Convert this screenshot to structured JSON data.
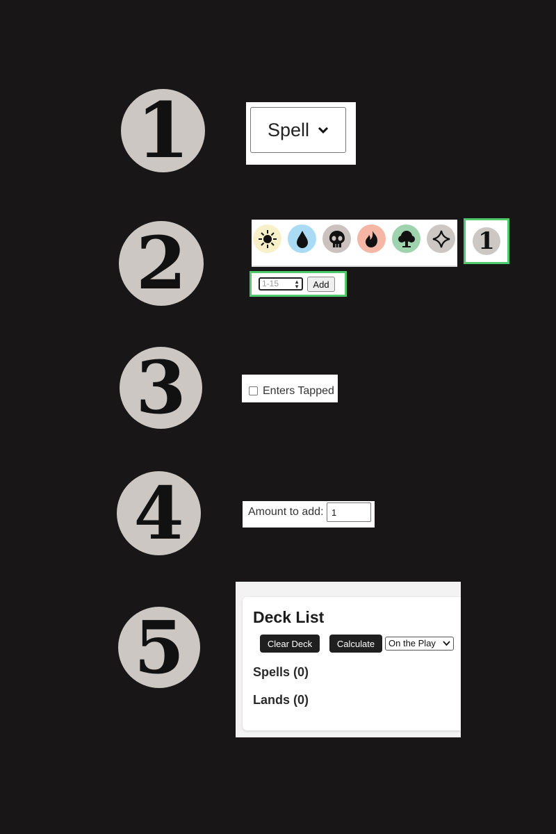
{
  "steps": [
    {
      "number": "1"
    },
    {
      "number": "2"
    },
    {
      "number": "3"
    },
    {
      "number": "4"
    },
    {
      "number": "5"
    }
  ],
  "step1": {
    "card_type_select": {
      "value": "Spell"
    }
  },
  "step2": {
    "mana_symbols": [
      {
        "name": "white",
        "icon": "sun-icon",
        "bg": "#f8f0c8"
      },
      {
        "name": "blue",
        "icon": "water-drop-icon",
        "bg": "#a9dcf4"
      },
      {
        "name": "black",
        "icon": "skull-icon",
        "bg": "#cbc2bf"
      },
      {
        "name": "red",
        "icon": "fire-icon",
        "bg": "#f5b6a6"
      },
      {
        "name": "green",
        "icon": "tree-icon",
        "bg": "#9fd3ae"
      },
      {
        "name": "colorless",
        "icon": "diamond-icon",
        "bg": "#ccc7c3"
      }
    ],
    "generic_symbol": "1",
    "generic_input": {
      "placeholder": "1-15"
    },
    "add_button": "Add",
    "highlight_color": "#4fc96b"
  },
  "step3": {
    "checkbox_label": "Enters Tapped",
    "checked": false
  },
  "step4": {
    "label": "Amount to add:",
    "value": "1"
  },
  "step5": {
    "title": "Deck List",
    "clear_button": "Clear Deck",
    "calculate_button": "Calculate",
    "play_select": {
      "value": "On the Play"
    },
    "spells_heading": "Spells (0)",
    "lands_heading": "Lands (0)"
  }
}
